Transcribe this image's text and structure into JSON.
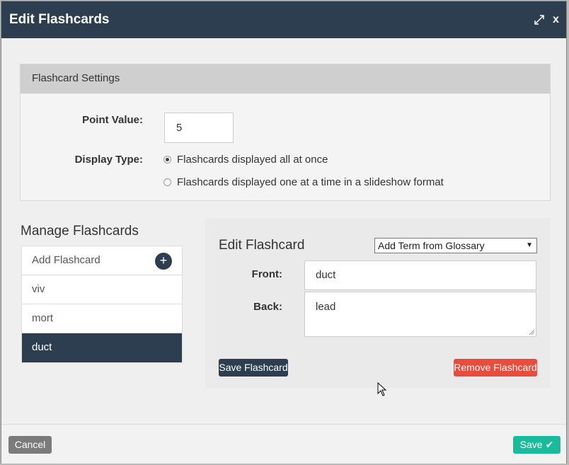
{
  "dialog": {
    "title": "Edit Flashcards",
    "close_label": "x"
  },
  "settings": {
    "heading": "Flashcard Settings",
    "point_value_label": "Point Value:",
    "point_value": "5",
    "display_type_label": "Display Type:",
    "display_options": [
      {
        "label": "Flashcards displayed all at once",
        "checked": true
      },
      {
        "label": "Flashcards displayed one at a time in a slideshow format",
        "checked": false
      }
    ]
  },
  "manage": {
    "title": "Manage Flashcards",
    "add_label": "Add Flashcard",
    "cards": [
      "viv",
      "mort",
      "duct"
    ],
    "active_card": "duct"
  },
  "edit": {
    "title": "Edit Flashcard",
    "glossary_selected": "Add Term from Glossary",
    "front_label": "Front:",
    "front_value": "duct",
    "back_label": "Back:",
    "back_value": "lead",
    "save_label": "Save Flashcard",
    "remove_label": "Remove Flashcard"
  },
  "footer": {
    "cancel_label": "Cancel",
    "save_label": "Save"
  },
  "colors": {
    "primary": "#2c3e50",
    "danger": "#e74c3c",
    "success": "#18bc9c",
    "default": "#7b7b7b"
  },
  "icons": [
    "expand-icon",
    "close-icon",
    "plus-icon",
    "check-icon",
    "mouse-cursor-icon"
  ]
}
